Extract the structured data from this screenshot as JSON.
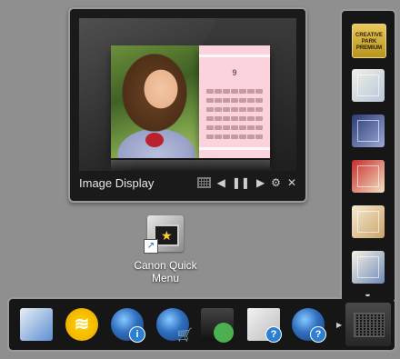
{
  "image_display": {
    "title": "Image Display",
    "calendar_month": "9",
    "controls": {
      "grid_view": "grid-icon",
      "previous": "◀",
      "pause": "❚❚",
      "next": "▶",
      "settings": "⚙",
      "close": "✕"
    }
  },
  "shortcut": {
    "label": "Canon Quick Menu",
    "icon": "canon-quick-menu-icon"
  },
  "launcher": {
    "creative_park_label": "CREATIVE PARK PREMIUM",
    "items": [
      "creative-park-premium-icon",
      "photo-collection-icon",
      "photo-album-icon",
      "photo-frame-icon",
      "photo-print-icon",
      "photo-layout-icon"
    ],
    "scroll_down": "▼"
  },
  "dock": {
    "items": [
      "document-photo-icon",
      "wireless-icon",
      "online-info-icon",
      "online-shop-icon",
      "printer-user-icon",
      "document-help-icon",
      "manual-help-icon"
    ],
    "wifi_symbol": "≋",
    "info_badge": "i",
    "help_badge": "?",
    "cart_symbol": "🛒",
    "scroll_right": "▶"
  },
  "colors": {
    "desktop": "#8f8f8f",
    "panel": "#161616",
    "panel_border": "#9a9a9a",
    "accent_gold": "#d4b13a"
  }
}
